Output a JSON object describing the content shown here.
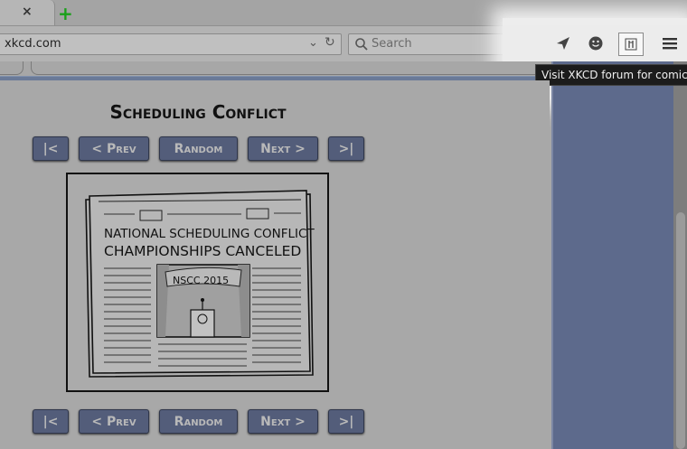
{
  "tab": {
    "close_label": "×",
    "new_tab_label": "+"
  },
  "urlbar": {
    "value": "xkcd.com",
    "dropdown": "⌄",
    "reload": "↻"
  },
  "searchbar": {
    "placeholder": "Search"
  },
  "tooltip": {
    "text": "Visit XKCD forum for comic"
  },
  "comic": {
    "title": "Scheduling Conflict",
    "nav": {
      "first": "|<",
      "prev": "< Prev",
      "random": "Random",
      "next": "Next >",
      "last": ">|"
    },
    "image": {
      "headline_line1": "NATIONAL SCHEDULING CONFLICT",
      "headline_line2": "CHAMPIONSHIPS CANCELED",
      "banner": "NSCC 2015"
    }
  },
  "colors": {
    "page_bg": "#a8a8a8",
    "button_bg": "#535d7a",
    "sidebar": "#5d6a8c",
    "tooltip_bg": "#1c1c1c"
  },
  "icons": [
    "close-icon",
    "plus-icon",
    "dropdown-icon",
    "reload-icon",
    "search-icon",
    "send-icon",
    "smiley-icon",
    "forum-icon",
    "menu-icon"
  ]
}
